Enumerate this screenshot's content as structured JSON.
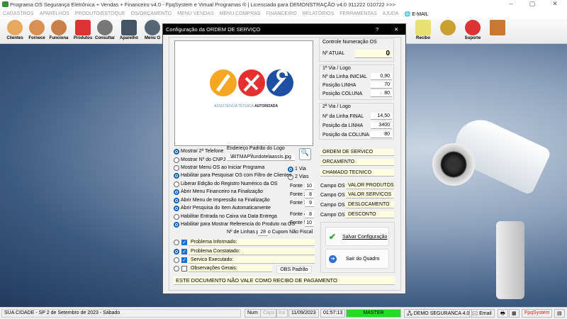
{
  "app": {
    "title": "Programa OS Segurança Eletrônica + Vendas + Financeiro v4.0 - FpqSystem e Virtual Programas ® | Licenciado para  DEMONSTRAÇÃO v4.0 311222 010722 >>>"
  },
  "menu": [
    "CADASTROS",
    "APARELHOS",
    "PRODUTO/ESTOQUE",
    "OS/ORÇAMENTO",
    "MENU VENDAS",
    "MENU COMPRAS",
    "FINANCEIRO",
    "RELATÓRIOS",
    "FERRAMENTAS",
    "AJUDA"
  ],
  "menu_email": "E-MAIL",
  "toolbar": {
    "clientes": "Clientes",
    "fornece": "Fornece",
    "funciona": "Funciona",
    "produtos": "Produtos",
    "consultar": "Consultar",
    "aparelho": "Aparelho",
    "menuos": "Menu O",
    "recibo": "Recibo",
    "suporte": "Suporte"
  },
  "dialog": {
    "title": "Configuração da ORDEM DE SERVIÇO",
    "help": "?",
    "close": "✕",
    "logo_text_a": "ASSISTÊNCIA TÉCNICA",
    "logo_text_b": "AUTORIZADA",
    "control": {
      "title": "Controle Numeração OS",
      "atual_label": "Nº ATUAL",
      "atual_value": "0"
    },
    "via1": {
      "title": "1ª Via / Logo",
      "rows": [
        {
          "label": "Nº da Linha INICIAL",
          "value": "0,90"
        },
        {
          "label": "Posição LINHA",
          "value": "70"
        },
        {
          "label": "Posição COLUNA",
          "value": "80"
        }
      ]
    },
    "via2": {
      "title": "2ª Via / Logo",
      "rows": [
        {
          "label": "Nº da Linha FINAL",
          "value": "14,50"
        },
        {
          "label": "Posição da LINHA",
          "value": "3400"
        },
        {
          "label": "Posição da COLUNA",
          "value": "80"
        }
      ]
    },
    "doc_titles": [
      "ORDEM DE SERVICO",
      "ORCAMENTO",
      "CHAMADO TECNICO"
    ],
    "campos": [
      {
        "label": "Campo OS 1",
        "value": "VALOR PRODUTOS"
      },
      {
        "label": "Campo OS 2",
        "value": "VALOR SERVICOS"
      },
      {
        "label": "Campo OS 3",
        "value": "DESLOCAMENTO"
      },
      {
        "label": "Campo OS 4",
        "value": "DESCONTO"
      }
    ],
    "logo_path_label": "Endereço Padrão do Logo",
    "logo_path": ".\\BITMAP\\fundotelaassis.jpg",
    "options": [
      {
        "label": "Mostrar 2ª Telefone",
        "on": true
      },
      {
        "label": "Mostrar Nº do CNPJ",
        "on": false
      },
      {
        "label": "Mostrar Menu OS ao Iniciar Programa",
        "on": false
      },
      {
        "label": "Habilitar para Pesquisar OS com Filtro de Clientes",
        "on": true
      },
      {
        "label": "Liberar Edição do Registro Numérico da OS",
        "on": false
      },
      {
        "label": "Abrir Menu Financeiro na Finalização",
        "on": true
      },
      {
        "label": "Abrir Menu de Impressão na Finalização",
        "on": true
      },
      {
        "label": "Abrir Pesquisa do Item Automaticamente",
        "on": true
      },
      {
        "label": "Habilitar Entrada no Caixa via Data Entrega",
        "on": false
      },
      {
        "label": "Habilitar para Mostrar Referencia do Produto na OS",
        "on": true
      }
    ],
    "vias": [
      {
        "label": "1 Via",
        "on": true
      },
      {
        "label": "2 Vias",
        "on": false
      }
    ],
    "fontes": [
      {
        "label": "Fonte 1",
        "value": "10"
      },
      {
        "label": "Fonte 2",
        "value": "8"
      },
      {
        "label": "Fonte 3",
        "value": "9"
      },
      {
        "label": "Fonte 4",
        "value": "8"
      },
      {
        "label": "Fonte 5",
        "value": "10"
      }
    ],
    "linhas_label": "Nº de Linhas para o Cupom Não Fiscal",
    "linhas_value": "28",
    "memos": [
      {
        "label": "Problema Informado:",
        "radio": false,
        "check": true
      },
      {
        "label": "Problema Constatado:",
        "radio": true,
        "check": true
      },
      {
        "label": "Servico Executado:",
        "radio": false,
        "check": true
      },
      {
        "label": "Observações Gerais:",
        "radio": false,
        "check": false
      }
    ],
    "obs_button": "OBS Padrão",
    "footer": "ESTE DOCUMENTO NÃO VALE COMO RECIBO DE PAGAMENTO",
    "save": "Salvar Configuração",
    "exit": "Sair do Quadro"
  },
  "status": {
    "city": "SUA CIDADE - SP  2 de Setembro de 2023 - Sábado",
    "num": "Num",
    "caps": "Caps",
    "ins": "Ins",
    "date": "11/09/2023",
    "time": "01:57:13",
    "user": "MASTER",
    "company": "DEMO SEGURANCA 4.0",
    "email": "Email",
    "brand": "FpqSystem"
  },
  "colors": {
    "accent": "#0a5fc2",
    "status_green": "#22dd22",
    "field_yellow": "#fffde0"
  }
}
